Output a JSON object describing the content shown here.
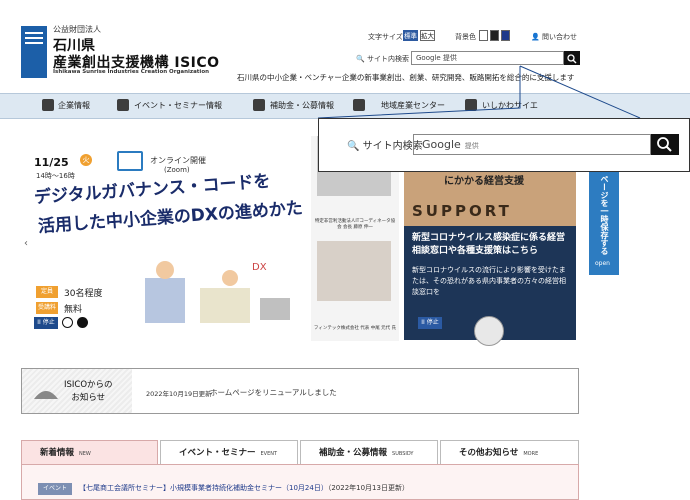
{
  "header": {
    "org_prefix": "公益財団法人",
    "org_name1": "石川県",
    "org_name2": "産業創出支援機構 ISICO",
    "org_en": "Ishikawa Sunrise Industries Creation Organization",
    "tagline": "石川県の中小企業・ベンチャー企業の新事業創出、創業、研究開発、販路開拓を総合的に支援します",
    "font_size_label": "文字サイズ",
    "font_standard": "標準",
    "font_large": "拡大",
    "color_label": "背景色",
    "contact": "問い合わせ",
    "search_label": "サイト内検索",
    "search_placeholder": "Google 提供"
  },
  "nav": [
    "企業情報",
    "イベント・セミナー情報",
    "補助金・公募情報",
    "地域産業センター",
    "いしかわサイエ"
  ],
  "zoom": {
    "search_label": "サイト内検索",
    "search_google": "Google",
    "search_provided": "提供"
  },
  "slide_left": {
    "date": "11/25",
    "day": "火",
    "time": "14時〜16時",
    "online": "オンライン開催",
    "zoom": "(Zoom)",
    "title1": "デジタルガバナンス・コードを",
    "title2": "活用した中小企業のDXの進めかた",
    "tag1": "定員",
    "tag1_text": "30名程度",
    "tag2": "受講料",
    "tag2_text": "無料",
    "stop": "II 停止",
    "prev_arrow": "‹"
  },
  "slide_mid": {
    "caption1": "特定非営利活動法人ITコーディネータ協会 会長 藤原 伸一",
    "caption2": "フィンテック株式会社 代表 中尾 元代 氏"
  },
  "slide_right": {
    "headline": "にかかる経営支援",
    "support": "SUPPORT",
    "title": "新型コロナウイルス感染症に係る経営相談窓口や各種支援策はこちら",
    "body": "新型コロナウイルスの流行により影響を受けたまたは、その恐れがある県内事業者の方々の経営相談窓口を",
    "stop": "II 停止"
  },
  "side_tab": {
    "label": "ページを一時保存する",
    "open": "open"
  },
  "news": {
    "title_line1": "ISICOからの",
    "title_line2": "お知らせ",
    "date": "2022年10月19日更新",
    "text": "ホームページをリニューアルしました"
  },
  "tabs": [
    {
      "label": "新着情報",
      "en": "NEW"
    },
    {
      "label": "イベント・セミナー",
      "en": "EVENT"
    },
    {
      "label": "補助金・公募情報",
      "en": "SUBSIDY"
    },
    {
      "label": "その他お知らせ",
      "en": "MORE"
    }
  ],
  "event_row": {
    "badge": "イベント",
    "text": "【七尾商工会議所セミナー】小規模事業者持続化補助金セミナー（10月24日）",
    "date": "（2022年10月13日更新）"
  },
  "colors": {
    "brand_blue": "#1c5fa8",
    "nav_bg": "#dde8f2",
    "side_tab": "#2d7cc1",
    "tab_active": "#fbe3e3"
  }
}
